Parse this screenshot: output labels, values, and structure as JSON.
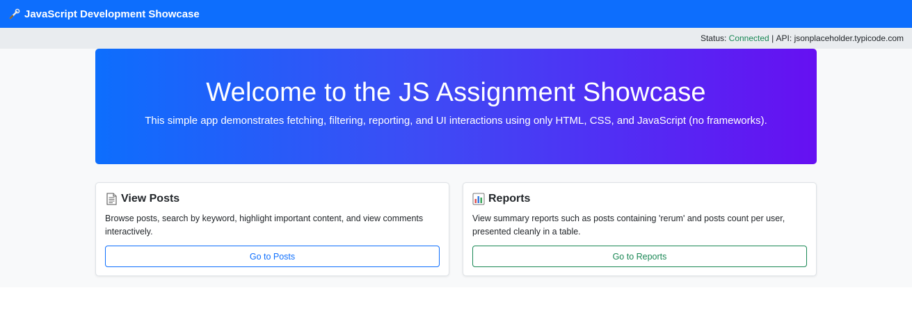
{
  "navbar": {
    "title": "JavaScript Development Showcase",
    "icon": "wrench-icon"
  },
  "status": {
    "label": "Status:",
    "value": "Connected",
    "separator": "|",
    "api_label": "API:",
    "api_value": "jsonplaceholder.typicode.com"
  },
  "hero": {
    "title": "Welcome to the JS Assignment Showcase",
    "subtitle": "This simple app demonstrates fetching, filtering, reporting, and UI interactions using only HTML, CSS, and JavaScript (no frameworks)."
  },
  "cards": [
    {
      "icon": "document-icon",
      "title": "View Posts",
      "text": "Browse posts, search by keyword, highlight important content, and view comments interactively.",
      "button": "Go to Posts"
    },
    {
      "icon": "bar-chart-icon",
      "title": "Reports",
      "text": "View summary reports such as posts containing 'rerum' and posts count per user, presented cleanly in a table.",
      "button": "Go to Reports"
    }
  ],
  "colors": {
    "primary": "#0d6efd",
    "success": "#198754",
    "gradient_end": "#6610f2"
  }
}
